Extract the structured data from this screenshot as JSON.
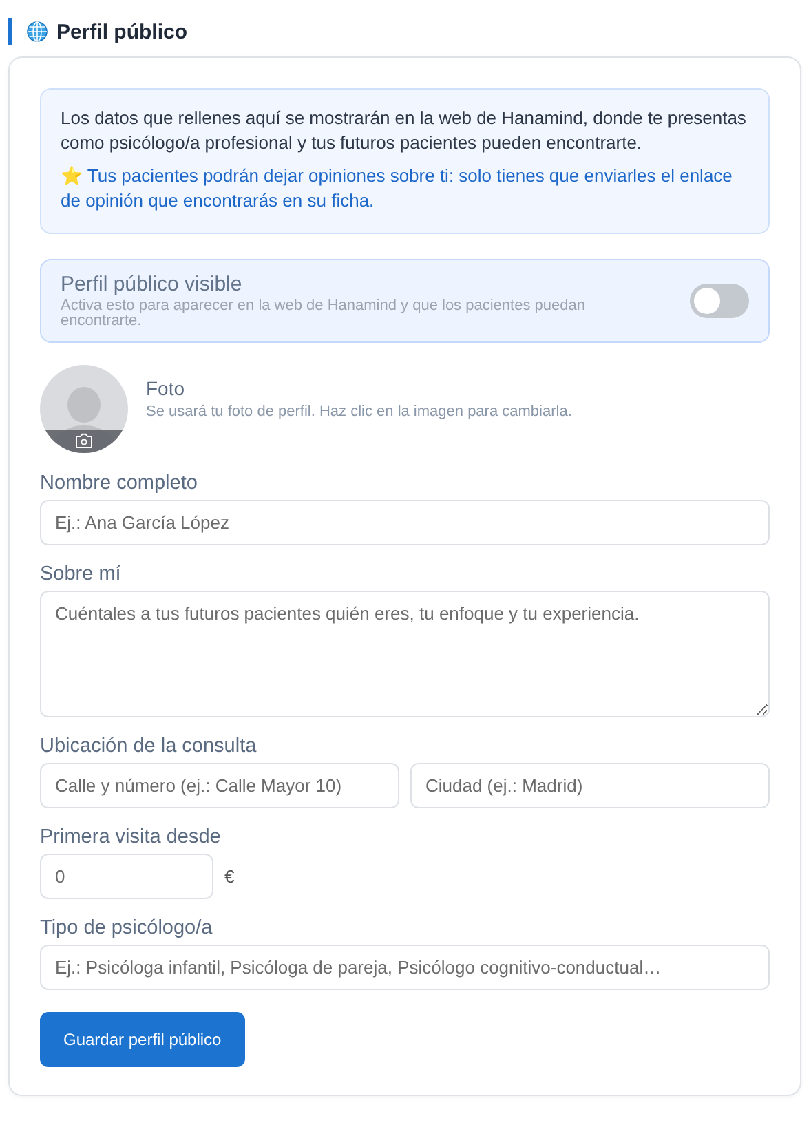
{
  "section": {
    "title": "Perfil público"
  },
  "info": {
    "text": "Los datos que rellenes aquí se mostrarán en la web de Hanamind, donde te presentas como psicólogo/a profesional y tus futuros pacientes pueden encontrarte.",
    "note": "⭐ Tus pacientes podrán dejar opiniones sobre ti: solo tienes que enviarles el enlace de opinión que encontrarás en su ficha."
  },
  "visibility": {
    "label": "Perfil público visible",
    "hint": "Activa esto para aparecer en la web de Hanamind y que los pacientes puedan encontrarte.",
    "on": false
  },
  "photo": {
    "label": "Foto",
    "hint": "Se usará tu foto de perfil. Haz clic en la imagen para cambiarla."
  },
  "fields": [
    {
      "kind": "text",
      "label": "Nombre completo",
      "inputs": [
        {
          "placeholder": "Ej.: Ana García López"
        }
      ]
    },
    {
      "kind": "textarea",
      "label": "Sobre mí",
      "inputs": [
        {
          "placeholder": "Cuéntales a tus futuros pacientes quién eres, tu enfoque y tu experiencia."
        }
      ]
    },
    {
      "kind": "pair",
      "label": "Ubicación de la consulta",
      "inputs": [
        {
          "placeholder": "Calle y número (ej.: Calle Mayor 10)"
        },
        {
          "placeholder": "Ciudad (ej.: Madrid)"
        }
      ]
    },
    {
      "kind": "price",
      "label": "Primera visita desde",
      "inputs": [
        {
          "placeholder": "0"
        }
      ],
      "unit": "€"
    },
    {
      "kind": "text",
      "label": "Tipo de psicólogo/a",
      "inputs": [
        {
          "placeholder": "Ej.: Psicóloga infantil, Psicóloga de pareja, Psicólogo cognitivo-conductual…"
        }
      ]
    }
  ],
  "save_button": "Guardar perfil público"
}
